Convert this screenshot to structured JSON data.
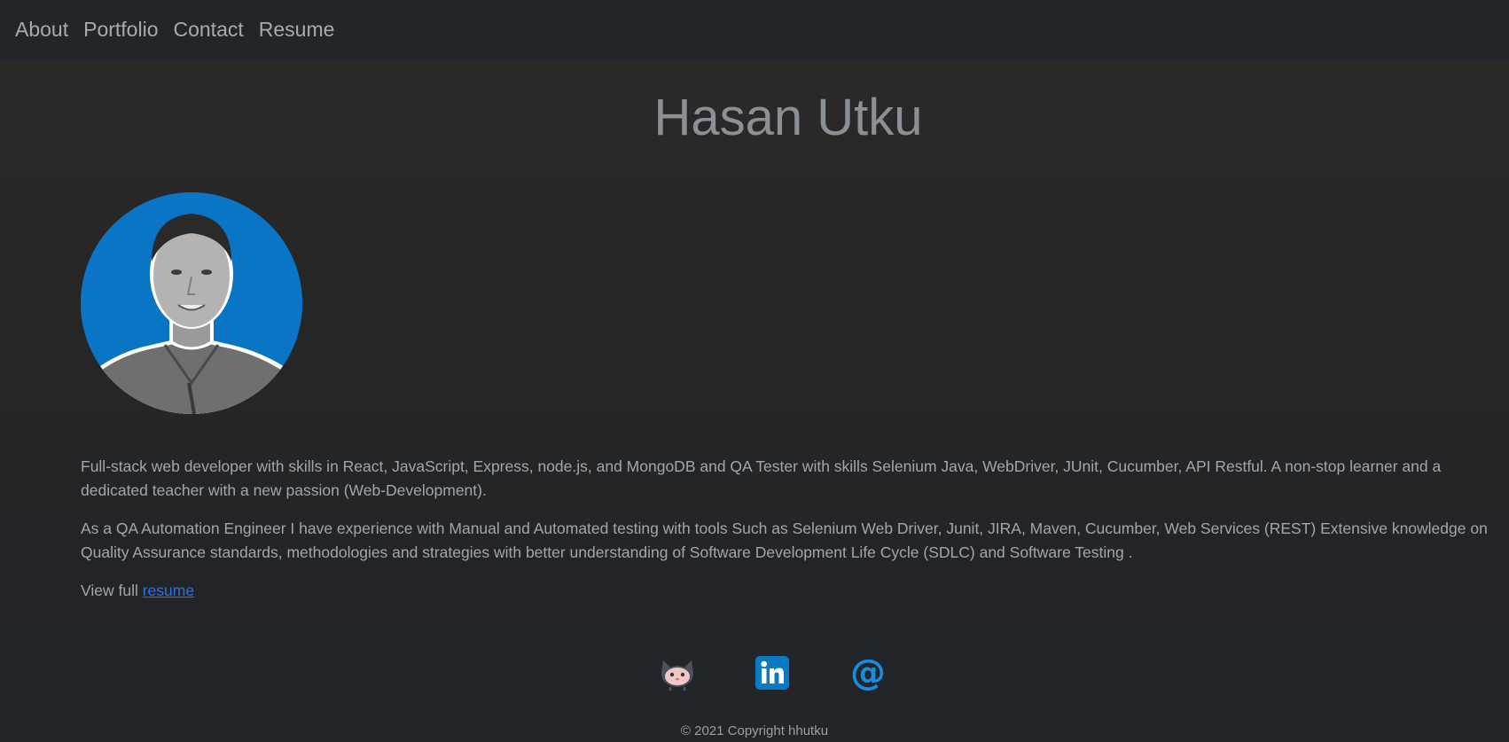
{
  "nav": {
    "items": [
      {
        "label": "About"
      },
      {
        "label": "Portfolio"
      },
      {
        "label": "Contact"
      },
      {
        "label": "Resume"
      }
    ]
  },
  "header": {
    "title": "Hasan Utku"
  },
  "bio": {
    "paragraph1": "Full-stack web developer with skills in React, JavaScript, Express, node.js, and MongoDB and QA Tester with skills Selenium Java, WebDriver, JUnit, Cucumber, API Restful. A non-stop learner and a dedicated teacher with a new passion (Web-Development).",
    "paragraph2": "As a QA Automation Engineer I have experience with Manual and Automated testing with tools Such as Selenium Web Driver, Junit, JIRA, Maven, Cucumber, Web Services (REST) Extensive knowledge on Quality Assurance standards, methodologies and strategies with better understanding of Software Development Life Cycle (SDLC) and Software Testing .",
    "view_prefix": "View full",
    "view_link": "resume"
  },
  "footer": {
    "icons": [
      "github-icon",
      "linkedin-icon",
      "email-icon"
    ],
    "copyright": "© 2021 Copyright hhutku"
  },
  "colors": {
    "navbar_bg": "#22252a",
    "link_blue": "#2f6fe5",
    "avatar_bg": "#0a74c5",
    "linkedin_blue": "#0a7ac4",
    "email_blue": "#1a8ce0"
  }
}
